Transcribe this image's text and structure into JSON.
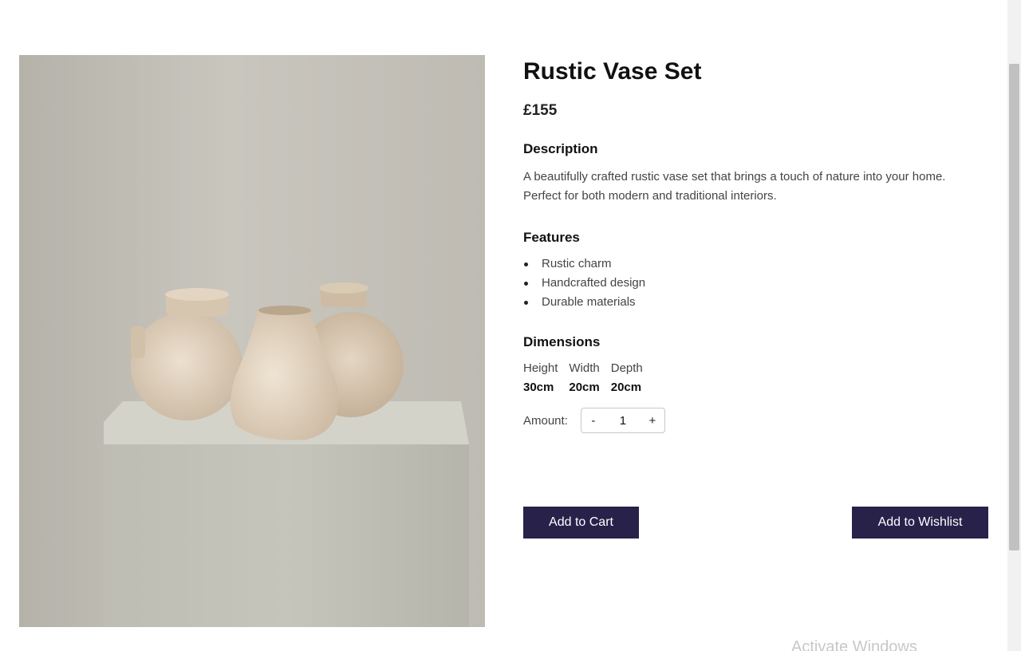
{
  "nav": {
    "items": [
      "",
      "",
      "",
      "",
      "",
      "",
      ""
    ]
  },
  "product": {
    "title": "Rustic Vase Set",
    "price": "£155",
    "image_icon": "vase-set-photo",
    "description_heading": "Description",
    "description": "A beautifully crafted rustic vase set that brings a touch of nature into your home. Perfect for both modern and traditional interiors.",
    "features_heading": "Features",
    "features": [
      "Rustic charm",
      "Handcrafted design",
      "Durable materials"
    ],
    "dimensions_heading": "Dimensions",
    "dimensions": [
      {
        "label": "Height",
        "value": "30cm"
      },
      {
        "label": "Width",
        "value": "20cm"
      },
      {
        "label": "Depth",
        "value": "20cm"
      }
    ],
    "amount_label": "Amount:",
    "quantity": "1",
    "decrement_label": "-",
    "increment_label": "+",
    "add_to_cart_label": "Add to Cart",
    "add_to_wishlist_label": "Add to Wishlist"
  },
  "os": {
    "watermark": "Activate Windows"
  },
  "colors": {
    "button_bg": "#28214a",
    "button_text": "#ffffff"
  }
}
